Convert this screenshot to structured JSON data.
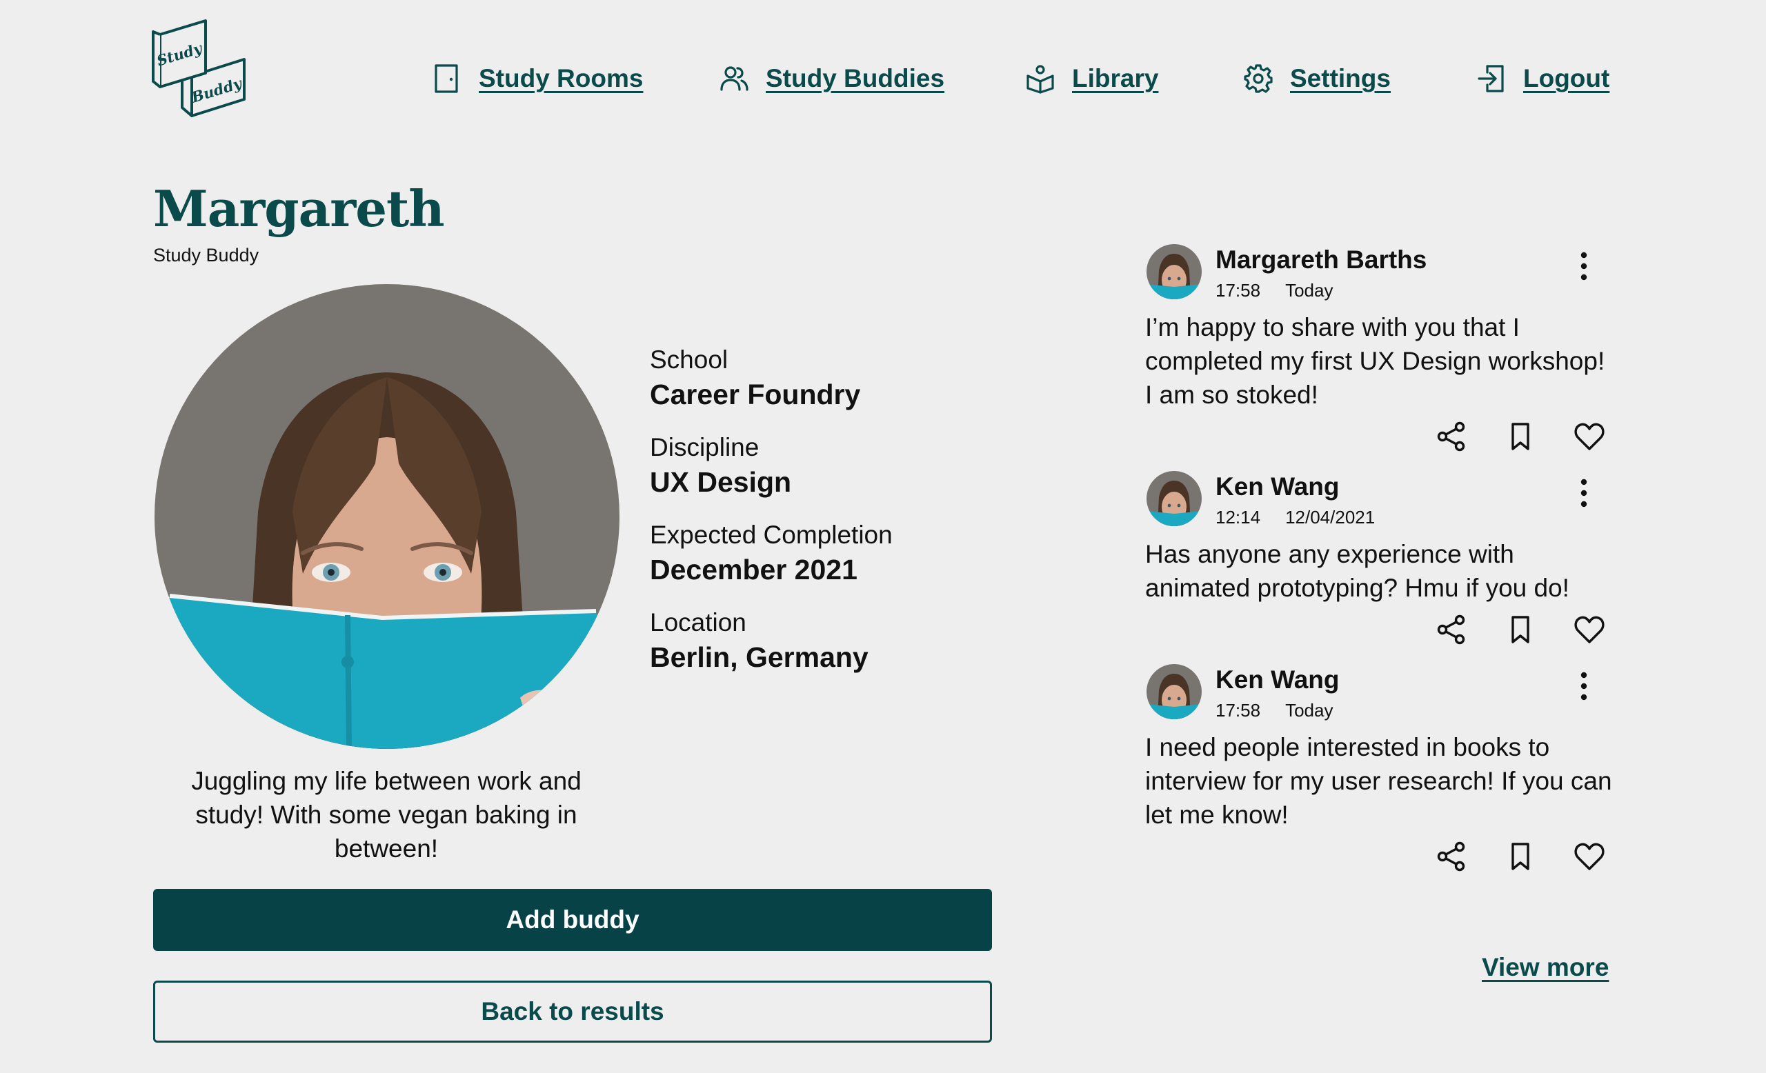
{
  "app": {
    "logo": {
      "word1": "Study",
      "word2": "Buddy"
    }
  },
  "colors": {
    "accent": "#0b4a4a",
    "button": "#074247",
    "background": "#eeeeee",
    "book": "#1ba9c2"
  },
  "nav": {
    "items": [
      {
        "label": "Study Rooms",
        "icon": "door-icon"
      },
      {
        "label": "Study Buddies",
        "icon": "users-icon"
      },
      {
        "label": "Library",
        "icon": "library-icon"
      },
      {
        "label": "Settings",
        "icon": "gear-icon"
      },
      {
        "label": "Logout",
        "icon": "logout-icon"
      }
    ]
  },
  "profile": {
    "name": "Margareth",
    "role": "Study Buddy",
    "details": [
      {
        "label": "School",
        "value": "Career Foundry"
      },
      {
        "label": "Discipline",
        "value": "UX Design"
      },
      {
        "label": "Expected Completion",
        "value": "December 2021"
      },
      {
        "label": "Location",
        "value": "Berlin, Germany"
      }
    ],
    "bio": "Juggling my life between work and study! With some vegan baking in between!",
    "add_button": "Add buddy",
    "back_button": "Back to results"
  },
  "feed": {
    "posts": [
      {
        "author": "Margareth Barths",
        "time": "17:58",
        "date": "Today",
        "text": "I’m happy to share with you that I completed my first UX Design workshop! I am so stoked!"
      },
      {
        "author": "Ken Wang",
        "time": "12:14",
        "date": "12/04/2021",
        "text": "Has anyone any experience with animated prototyping? Hmu if you do!"
      },
      {
        "author": "Ken Wang",
        "time": "17:58",
        "date": "Today",
        "text": "I need people interested in books to interview for my user research! If you can let me know!"
      }
    ],
    "view_more": "View more"
  }
}
